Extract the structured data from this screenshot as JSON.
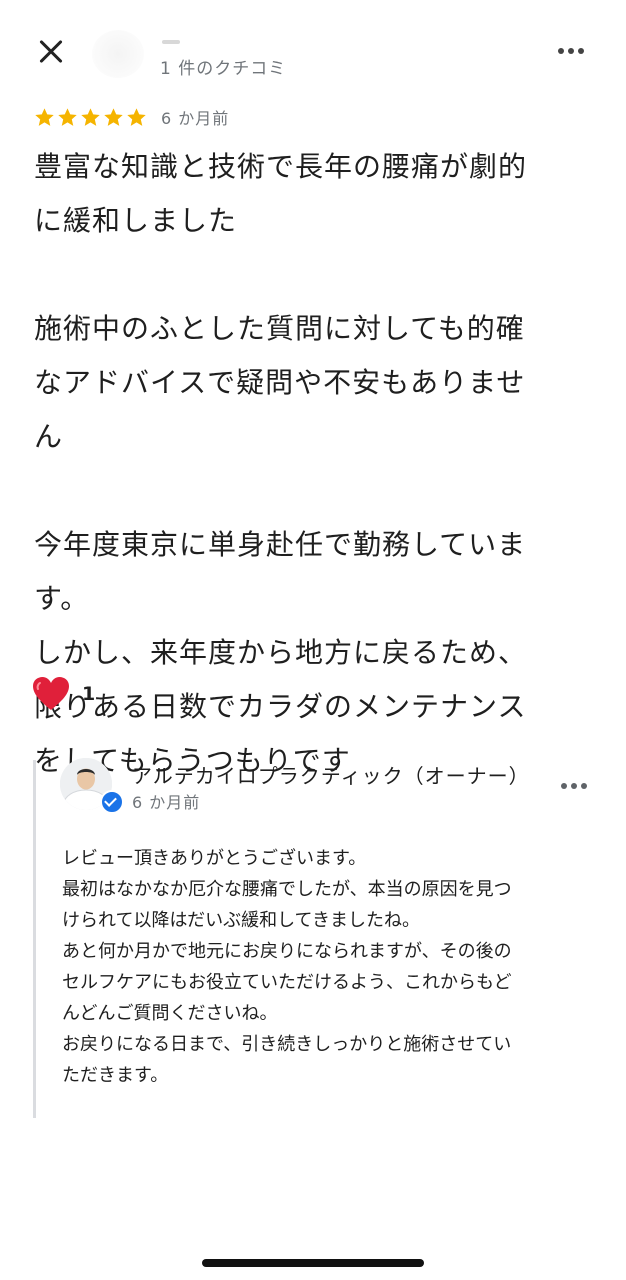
{
  "header": {
    "review_count": "1 件のクチコミ"
  },
  "review": {
    "rating": 5,
    "max_rating": 5,
    "time_ago": "6 か月前",
    "text": "豊富な知識と技術で長年の腰痛が劇的\nに緩和しました\n\n施術中のふとした質問に対しても的確\nなアドバイスで疑問や不安もありませ\nん\n\n今年度東京に単身赴任で勤務していま\nす。\nしかし、来年度から地方に戻るため、\n限りある日数でカラダのメンテナンス\nをしてもらうつもりです",
    "like_count": "1"
  },
  "owner_reply": {
    "name": "アルテカイロプラクティック（オーナー）",
    "time_ago": "6 か月前",
    "text": "レビュー頂きありがとうございます。\n最初はなかなか厄介な腰痛でしたが、本当の原因を見つ\nけられて以降はだいぶ緩和してきましたね。\nあと何か月かで地元にお戻りになられますが、その後の\nセルフケアにもお役立ていただけるよう、これからもど\nんどんご質問くださいね。\nお戻りになる日まで、引き続きしっかりと施術させてい\nただきます。"
  },
  "colors": {
    "star": "#f5b400",
    "heart": "#e0203a",
    "verified": "#1a73e8",
    "secondary_text": "#70757a"
  }
}
